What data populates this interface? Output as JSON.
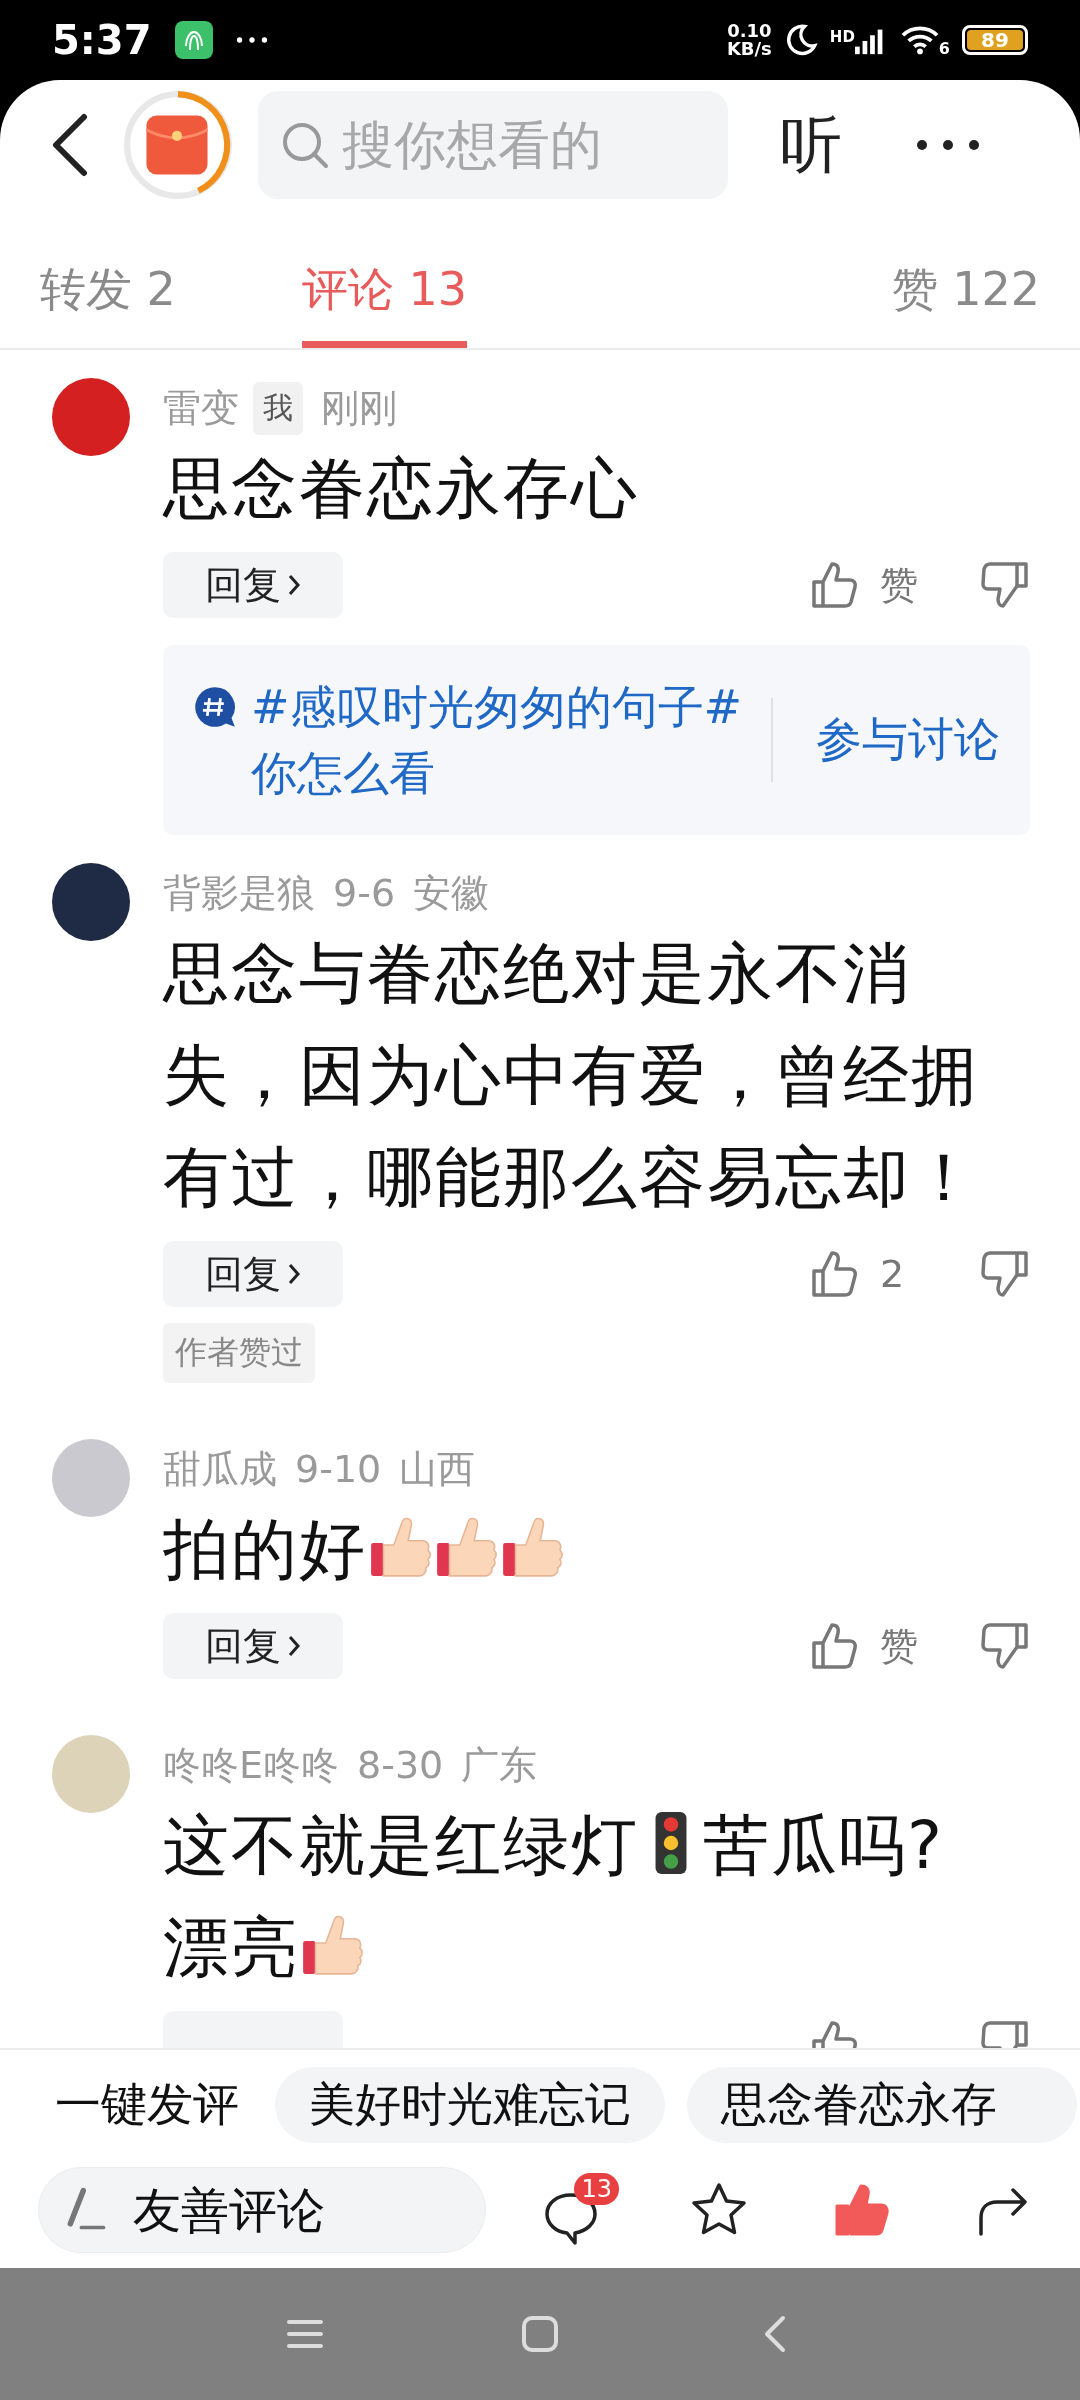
{
  "status_bar": {
    "time": "5:37",
    "speed_value": "0.10",
    "speed_unit": "KB/s",
    "network": "HD",
    "wifi_gen": "6",
    "battery": "89"
  },
  "header": {
    "search": {
      "placeholder": "搜你想看的"
    },
    "listen": "听"
  },
  "tabs": [
    {
      "label": "转发 2",
      "selected": false
    },
    {
      "label": "评论 13",
      "selected": true
    },
    {
      "label": "赞 122",
      "selected": false
    }
  ],
  "comments": [
    {
      "name": "雷变",
      "me_badge": "我",
      "time": "刚刚",
      "color": "#d42020",
      "content": [
        {
          "kind": "text",
          "text": "思念眷恋永存心"
        }
      ],
      "reply": "回复",
      "like": "赞",
      "liked": false,
      "topic": {
        "text": "#感叹时光匆匆的句子# 你怎么看",
        "action": "参与讨论"
      }
    },
    {
      "name": "背影是狼",
      "time": "9-6",
      "location": "安徽",
      "color": "#1f2a44",
      "content": [
        {
          "kind": "text",
          "text": "思念与眷恋绝对是永不消失，因为心中有爱，曾经拥有过，哪能那么容易忘却！"
        }
      ],
      "reply": "回复",
      "like": "2",
      "liked": false,
      "tag": "作者赞过"
    },
    {
      "name": "甜瓜成",
      "time": "9-10",
      "location": "山西",
      "color": "#c9c9cf",
      "content": [
        {
          "kind": "text",
          "text": "拍的好"
        },
        {
          "kind": "thumbs"
        },
        {
          "kind": "thumbs"
        },
        {
          "kind": "thumbs"
        }
      ],
      "reply": "回复",
      "like": "赞",
      "liked": false
    },
    {
      "name": "咚咚E咚咚",
      "time": "8-30",
      "location": "广东",
      "color": "#dcd3b8",
      "content": [
        {
          "kind": "text",
          "text": "这不就是红绿灯"
        },
        {
          "kind": "traffic-light"
        },
        {
          "kind": "text",
          "text": "苦瓜吗?"
        },
        {
          "kind": "text",
          "text": "漂亮"
        },
        {
          "kind": "thumbs"
        }
      ],
      "liked": false
    }
  ],
  "quick_comment": {
    "label": "一键发评",
    "chips": [
      "美好时光难忘记",
      "思念眷恋永存"
    ]
  },
  "bottom_bar": {
    "placeholder": "友善评论",
    "comment_count": "13",
    "favorited": false,
    "liked": true
  }
}
